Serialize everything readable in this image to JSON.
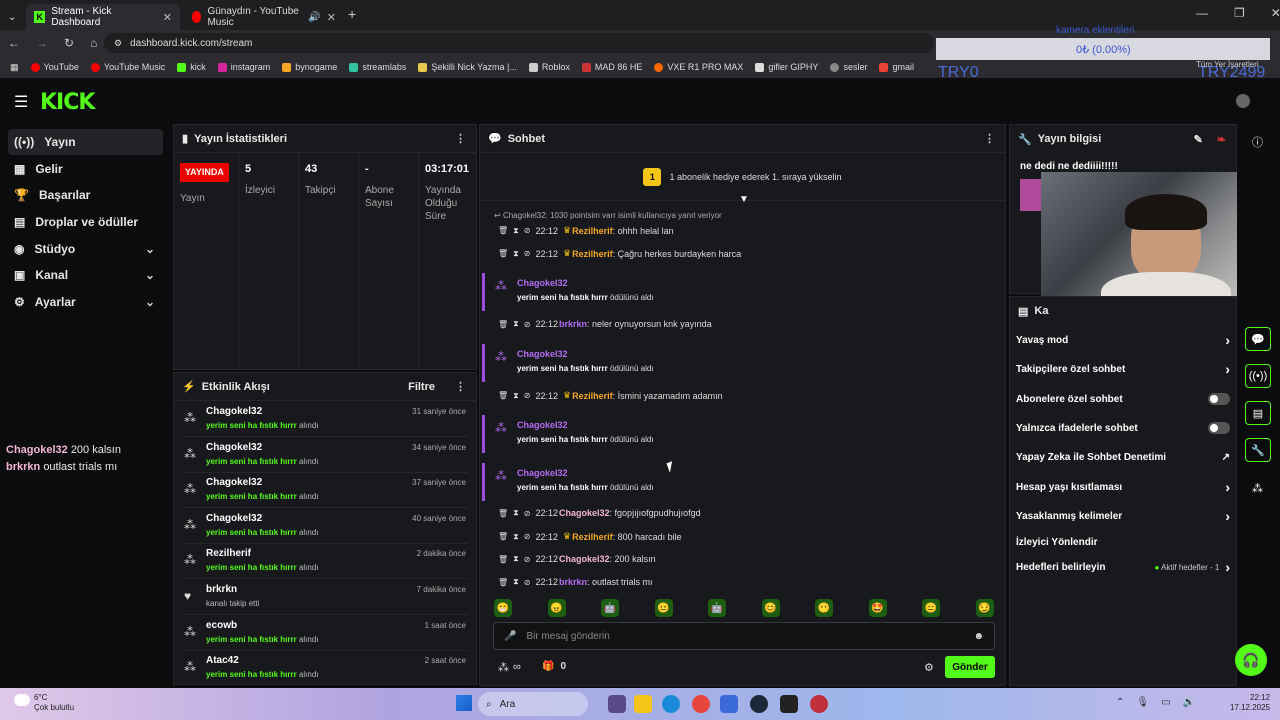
{
  "browser": {
    "tabs": [
      {
        "title": "Stream - Kick Dashboard",
        "active": true
      },
      {
        "title": "Günaydın - YouTube Music",
        "active": false
      }
    ],
    "url": "dashboard.kick.com/stream",
    "bookmarks": [
      "YouTube",
      "YouTube Music",
      "kick",
      "instagram",
      "bynogame",
      "streamlabs",
      "Şekilli Nick Yazma |...",
      "Roblox",
      "MAD 86 HE",
      "VXE R1 PRO MAX",
      "gifler GIPHY",
      "sesler",
      "gmail"
    ],
    "all_bookmarks": "Tüm Yer İşaretleri"
  },
  "overlay": {
    "label": "kamera eklentileri",
    "value": "0₺ (0.00%)",
    "left_text": "TRY0",
    "right_text": "TRY2499"
  },
  "sidebar": {
    "items": [
      {
        "label": "Yayın",
        "icon": "broadcast-icon",
        "active": true
      },
      {
        "label": "Gelir",
        "icon": "revenue-icon"
      },
      {
        "label": "Başarılar",
        "icon": "trophy-icon"
      },
      {
        "label": "Droplar ve ödüller",
        "icon": "gift-icon"
      },
      {
        "label": "Stüdyo",
        "icon": "studio-icon",
        "expandable": true
      },
      {
        "label": "Kanal",
        "icon": "channel-icon",
        "expandable": true
      },
      {
        "label": "Ayarlar",
        "icon": "gear-icon",
        "expandable": true
      }
    ]
  },
  "overlay_chat": [
    {
      "user": "Chagokel32",
      "text": "200 kalsın"
    },
    {
      "user": "brkrkn",
      "text": "outlast trials mı"
    }
  ],
  "stats": {
    "title": "Yayın İstatistikleri",
    "live_badge": "YAYINDA",
    "stream_label": "Yayın",
    "viewers": {
      "value": "5",
      "label": "İzleyici"
    },
    "followers": {
      "value": "43",
      "label": "Takipçi"
    },
    "subs": {
      "value": "-",
      "label": "Abone Sayısı"
    },
    "duration": {
      "value": "03:17:01",
      "label": "Yayında Olduğu Süre"
    }
  },
  "activity": {
    "title": "Etkinlik Akışı",
    "filter": "Filtre",
    "items": [
      {
        "user": "Chagokel32",
        "reward": "yerim seni ha fıstık hırrr",
        "suffix": "alındı",
        "time": "31 saniye önce"
      },
      {
        "user": "Chagokel32",
        "reward": "yerim seni ha fıstık hırrr",
        "suffix": "alındı",
        "time": "34 saniye önce"
      },
      {
        "user": "Chagokel32",
        "reward": "yerim seni ha fıstık hırrr",
        "suffix": "alındı",
        "time": "37 saniye önce"
      },
      {
        "user": "Chagokel32",
        "reward": "yerim seni ha fıstık hırrr",
        "suffix": "alındı",
        "time": "40 saniye önce"
      },
      {
        "user": "Rezilherif",
        "reward": "yerim seni ha fıstık hırrr",
        "suffix": "alındı",
        "time": "2 dakika önce"
      },
      {
        "user": "brkrkn",
        "reward": "",
        "suffix": "kanalı takip etti",
        "time": "7 dakika önce"
      },
      {
        "user": "ecowb",
        "reward": "yerim seni ha fıstık hırrr",
        "suffix": "alındı",
        "time": "1 saat önce"
      },
      {
        "user": "Atac42",
        "reward": "yerim seni ha fıstık hırrr",
        "suffix": "alındı",
        "time": "2 saat önce"
      }
    ]
  },
  "chat": {
    "title": "Sohbet",
    "pinned": "1 abonelik hediye ederek 1. sıraya yükselin",
    "pinned_rank": "1",
    "reply_hint": "Chagokel32: 1030 pointsim varr isimli kullanıcıya yanıt veriyor",
    "messages": [
      {
        "kind": "msg",
        "time": "22:12",
        "user": "Rezilherif",
        "color": "#f5a623",
        "crown": true,
        "text": ": ohhh helal lan"
      },
      {
        "kind": "msg",
        "time": "22:12",
        "user": "Rezilherif",
        "color": "#f5a623",
        "crown": true,
        "text": ": Çağru herkes burdayken harca"
      },
      {
        "kind": "redeem",
        "user": "Chagokel32",
        "reward": "yerim seni ha fıstık hırrr",
        "suffix": "ödülünü aldı"
      },
      {
        "kind": "msg",
        "time": "22:12",
        "user": "brkrkn",
        "color": "#b56cf5",
        "crown": false,
        "text": ": neler oynuyorsun knk yayında"
      },
      {
        "kind": "redeem",
        "user": "Chagokel32",
        "reward": "yerim seni ha fıstık hırrr",
        "suffix": "ödülünü aldı"
      },
      {
        "kind": "msg",
        "time": "22:12",
        "user": "Rezilherif",
        "color": "#f5a623",
        "crown": true,
        "text": ": İsmini yazamadım adamın"
      },
      {
        "kind": "redeem",
        "user": "Chagokel32",
        "reward": "yerim seni ha fıstık hırrr",
        "suffix": "ödülünü aldı"
      },
      {
        "kind": "redeem",
        "user": "Chagokel32",
        "reward": "yerim seni ha fıstık hırrr",
        "suffix": "ödülünü aldı"
      },
      {
        "kind": "msg",
        "time": "22:12",
        "user": "Chagokel32",
        "color": "#f5b6d3",
        "crown": false,
        "text": ": fgopjıjıofgpudhujıofgd"
      },
      {
        "kind": "msg",
        "time": "22:12",
        "user": "Rezilherif",
        "color": "#f5a623",
        "crown": true,
        "text": ": 800 harcadı bile"
      },
      {
        "kind": "msg",
        "time": "22:12",
        "user": "Chagokel32",
        "color": "#f5b6d3",
        "crown": false,
        "text": ": 200 kalsın"
      },
      {
        "kind": "msg",
        "time": "22:12",
        "user": "brkrkn",
        "color": "#b56cf5",
        "crown": false,
        "text": ": outlast trials mı"
      }
    ],
    "input_placeholder": "Bir mesaj gönderin",
    "infinity": "∞",
    "gift_count": "0",
    "send": "Gönder",
    "emotes": [
      "😁",
      "😠",
      "🤖",
      "😐",
      "🤖",
      "😊",
      "😶",
      "🤩",
      "😑",
      "😏"
    ]
  },
  "stream_info": {
    "title": "Yayın bilgisi",
    "text": "ne dedi ne dediiii!!!!!"
  },
  "chat_settings": {
    "title": "Ka",
    "rows": [
      {
        "label": "Yavaş mod",
        "type": "chevron"
      },
      {
        "label": "Takipçilere özel sohbet",
        "type": "chevron"
      },
      {
        "label": "Abonelere özel sohbet",
        "type": "toggle"
      },
      {
        "label": "Yalnızca ifadelerle sohbet",
        "type": "toggle"
      },
      {
        "label": "Yapay Zeka ile Sohbet Denetimi",
        "type": "external"
      },
      {
        "label": "Hesap yaşı kısıtlaması",
        "type": "chevron"
      },
      {
        "label": "Yasaklanmış kelimeler",
        "type": "chevron"
      },
      {
        "label": "İzleyici Yönlendir",
        "type": "none"
      },
      {
        "label": "Hedefleri belirleyin",
        "type": "chevron",
        "extra": "Aktif hedefler - 1"
      }
    ]
  },
  "taskbar": {
    "weather_temp": "6°C",
    "weather_desc": "Çok bulutlu",
    "search": "Ara",
    "time": "22:12",
    "date": "17.12.2025"
  },
  "colors": {
    "kick_green": "#53fc18",
    "live_red": "#eb0400",
    "purple": "#9b4ee0"
  }
}
